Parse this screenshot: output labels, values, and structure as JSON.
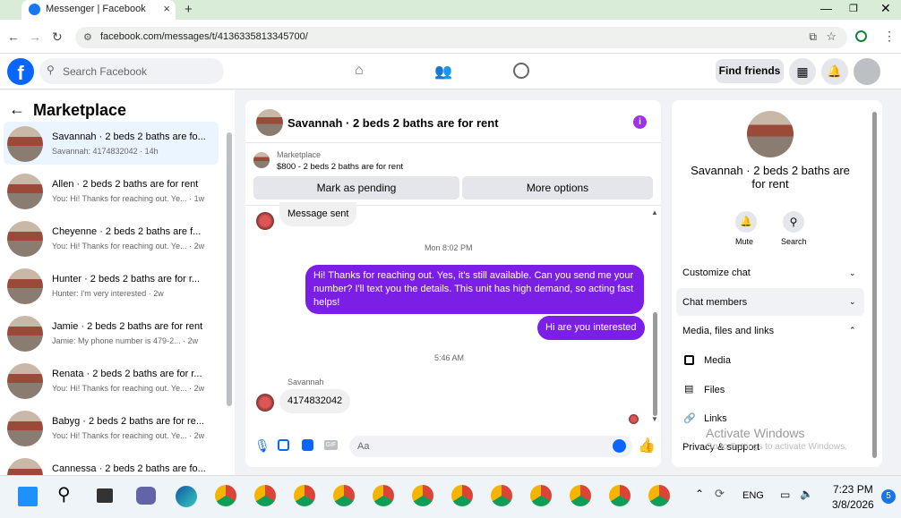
{
  "browser": {
    "tab_title": "Messenger | Facebook",
    "url": "facebook.com/messages/t/4136335813345700/"
  },
  "header": {
    "search_placeholder": "Search Facebook",
    "find_friends": "Find friends"
  },
  "left": {
    "title": "Marketplace",
    "items": [
      {
        "name": "Savannah · 2 beds 2 baths are fo...",
        "sub": "Savannah: 4174832042 · 14h"
      },
      {
        "name": "Allen · 2 beds 2 baths are for rent",
        "sub": "You: Hi! Thanks for reaching out. Ye... · 1w"
      },
      {
        "name": "Cheyenne · 2 beds 2 baths are f...",
        "sub": "You: Hi! Thanks for reaching out. Ye... · 2w"
      },
      {
        "name": "Hunter · 2 beds 2 baths are for r...",
        "sub": "Hunter: I'm very interested · 2w"
      },
      {
        "name": "Jamie · 2 beds 2 baths are for rent",
        "sub": "Jamie: My phone number is 479-2... · 2w"
      },
      {
        "name": "Renata · 2 beds 2 baths are for r...",
        "sub": "You: Hi! Thanks for reaching out. Ye... · 2w"
      },
      {
        "name": "Babyg · 2 beds 2 baths are for re...",
        "sub": "You: Hi! Thanks for reaching out. Ye... · 2w"
      },
      {
        "name": "Cannessa · 2 beds 2 baths are fo...",
        "sub": ""
      }
    ]
  },
  "chat": {
    "title": "Savannah · 2 beds 2 baths are for rent",
    "market_label": "Marketplace",
    "listing": "$800 - 2 beds 2 baths are for rent",
    "mark_pending": "Mark as pending",
    "more_options": "More options",
    "msg_sent": "Message sent",
    "time1": "Mon 8:02 PM",
    "reply1": "Hi! Thanks for reaching out. Yes, it's still available. Can you send me your number? I'll text you the details. This unit has high demand, so acting fast helps!",
    "reply2": "Hi are you interested",
    "time2": "5:46 AM",
    "sender": "Savannah",
    "their_msg": "4174832042",
    "input_placeholder": "Aa"
  },
  "right": {
    "name": "Savannah · 2 beds 2 baths are for rent",
    "mute": "Mute",
    "search": "Search",
    "customize": "Customize chat",
    "members": "Chat members",
    "media_files": "Media, files and links",
    "media": "Media",
    "files": "Files",
    "links": "Links",
    "privacy": "Privacy & support",
    "watermark1": "Activate Windows",
    "watermark2": "Go to Settings to activate Windows."
  },
  "taskbar": {
    "time": "7:23 PM",
    "date": "3/8/2026",
    "lang": "ENG",
    "badge": "5"
  }
}
